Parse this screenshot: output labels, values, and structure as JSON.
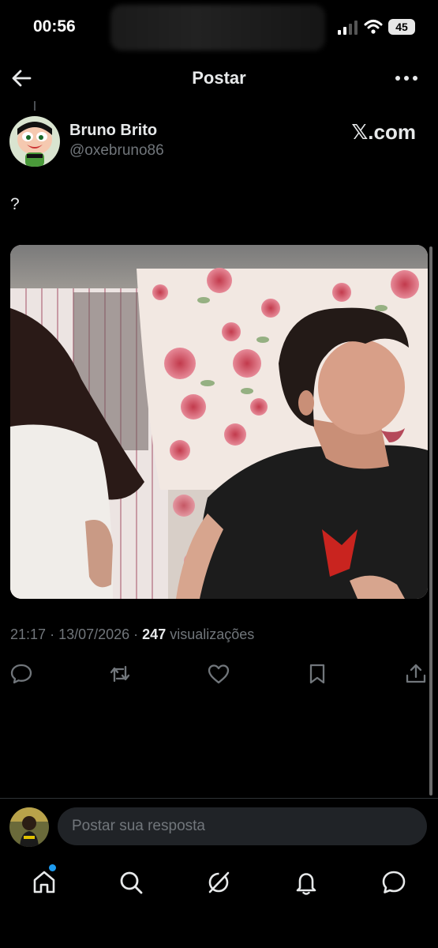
{
  "status_bar": {
    "time": "00:56",
    "battery": "45"
  },
  "header": {
    "title": "Postar"
  },
  "author": {
    "name": "Bruno Brito",
    "handle": "@oxebruno86"
  },
  "watermark": "𝕏.com",
  "post": {
    "text": "?",
    "time": "21:17",
    "date": "13/07/2026",
    "views_count": "247",
    "views_label": "visualizações"
  },
  "reply": {
    "placeholder": "Postar sua resposta"
  },
  "colors": {
    "background": "#000000",
    "muted": "#71767b",
    "accent": "#1d9bf0",
    "input_bg": "#202327"
  },
  "icons": {
    "header": [
      "back-arrow-icon",
      "more-icon"
    ],
    "actions": [
      "reply-icon",
      "repost-icon",
      "like-icon",
      "bookmark-icon",
      "share-icon"
    ],
    "nav": [
      "home-icon",
      "search-icon",
      "grok-icon",
      "notifications-icon",
      "messages-icon"
    ]
  }
}
